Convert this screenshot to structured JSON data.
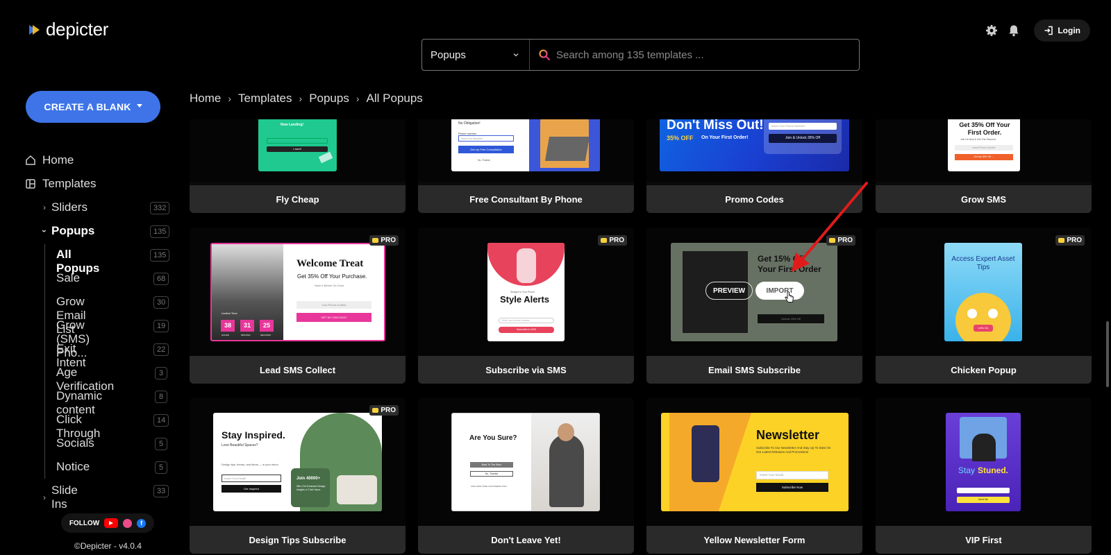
{
  "app": {
    "logo_text": "depicter",
    "brand_color": "#3e74e8"
  },
  "search": {
    "category": "Popups",
    "placeholder": "Search among 135 templates ..."
  },
  "header": {
    "login_label": "Login"
  },
  "sidebar": {
    "create_label": "CREATE A BLANK",
    "home_label": "Home",
    "templates_label": "Templates",
    "groups": [
      {
        "label": "Sliders",
        "count": "332"
      },
      {
        "label": "Popups",
        "count": "135"
      },
      {
        "label": "Slide Ins",
        "count": "33"
      }
    ],
    "popup_items": [
      {
        "label": "All Popups",
        "count": "135"
      },
      {
        "label": "Sale",
        "count": "68"
      },
      {
        "label": "Grow Email List",
        "count": "30"
      },
      {
        "label": "Grow (SMS) Pho...",
        "count": "19"
      },
      {
        "label": "Exit Intent",
        "count": "22"
      },
      {
        "label": "Age Verification",
        "count": "3"
      },
      {
        "label": "Dynamic content",
        "count": "8"
      },
      {
        "label": "Click Through",
        "count": "14"
      },
      {
        "label": "Socials",
        "count": "5"
      },
      {
        "label": "Notice",
        "count": "5"
      }
    ],
    "follow_label": "FOLLOW",
    "version": "©Depicter - v4.0.4"
  },
  "breadcrumb": [
    "Home",
    "Templates",
    "Popups",
    "All Popups"
  ],
  "pro_label": "PRO",
  "overlay": {
    "preview": "PREVIEW",
    "import": "IMPORT"
  },
  "templates": [
    {
      "title": "Fly Cheap"
    },
    {
      "title": "Free Consultant By Phone"
    },
    {
      "title": "Promo Codes"
    },
    {
      "title": "Grow SMS"
    },
    {
      "title": "Lead SMS Collect",
      "pro": true
    },
    {
      "title": "Subscribe via SMS",
      "pro": true
    },
    {
      "title": "Email SMS Subscribe",
      "pro": true
    },
    {
      "title": "Chicken Popup",
      "pro": true
    },
    {
      "title": "Design Tips Subscribe",
      "pro": true
    },
    {
      "title": "Don't Leave Yet!"
    },
    {
      "title": "Yellow Newsletter Form"
    },
    {
      "title": "VIP First"
    }
  ],
  "thumb_text": {
    "fly_cheap": {
      "line1": "Now Landing!",
      "button": "I want!"
    },
    "consultant": {
      "line1": "No Obligation!",
      "label": "Phone number",
      "input": "Insert Your Number*",
      "button": "Get my Free Consultation",
      "decline": "No, Thanks"
    },
    "promo": {
      "headline": "Don't Miss Out!",
      "sub": "35% OFF",
      "sub2": "On Your First Order!",
      "input": "Insert Your Phone Number*",
      "button": "Join & Unlock 35% Off"
    },
    "grow_sms": {
      "headline": "Get 35% Off Your First Order.",
      "sub": "Join Us Now & Get The Discount",
      "input": "Insert Phone Number",
      "button": "Get My 35% Off →"
    },
    "lead": {
      "headline": "Welcome Treat",
      "sub": "Get 35% Off Your Purchase.",
      "note": "Save It Before It's Gone",
      "timer_label": "Limited Time",
      "hours": "38",
      "minutes": "31",
      "seconds": "25",
      "u1": "HOURS",
      "u2": "MINUTES",
      "u3": "SECONDS",
      "input": "Your Phone number",
      "button": "GET MY DISCOUNT"
    },
    "subscribe": {
      "kicker": "Straight to Your Phone",
      "headline": "Style Alerts",
      "input": "Enter your phone number",
      "button": "Subscribe to SMS"
    },
    "email": {
      "headline1": "Get 15% Off",
      "headline2": "Your First Order",
      "button": "Unlock 15% Off"
    },
    "chicken": {
      "headline": "Access Expert Asset Tips",
      "button": "Let's Go"
    },
    "design": {
      "headline": "Stay Inspired.",
      "sub": "Love Beautiful Spaces?",
      "body": "Design tips, trends, and ideas — in your inbox.",
      "input": "Insert Your Email*",
      "button": "Get Inspired",
      "badge": "Join 40000+",
      "badge_sub": "Who Get Exclusive Design Insights in Their Inbox."
    },
    "dont_leave": {
      "headline": "Are You Sure?",
      "button1": "Back To The Store",
      "button2": "No, Thanks!",
      "note": "FOR FIRST-TIME CUSTOMERS ONLY"
    },
    "newsletter": {
      "headline": "Newsletter",
      "body": "Subscribe To Our Newsletter And Stay Up To Date On Our Latest Releases And Promotions!",
      "input": "Insert Your Email",
      "button": "Subscribe Now"
    },
    "vip": {
      "headline1": "Stay",
      "headline2": "Stuned.",
      "button": "Send Me"
    }
  }
}
